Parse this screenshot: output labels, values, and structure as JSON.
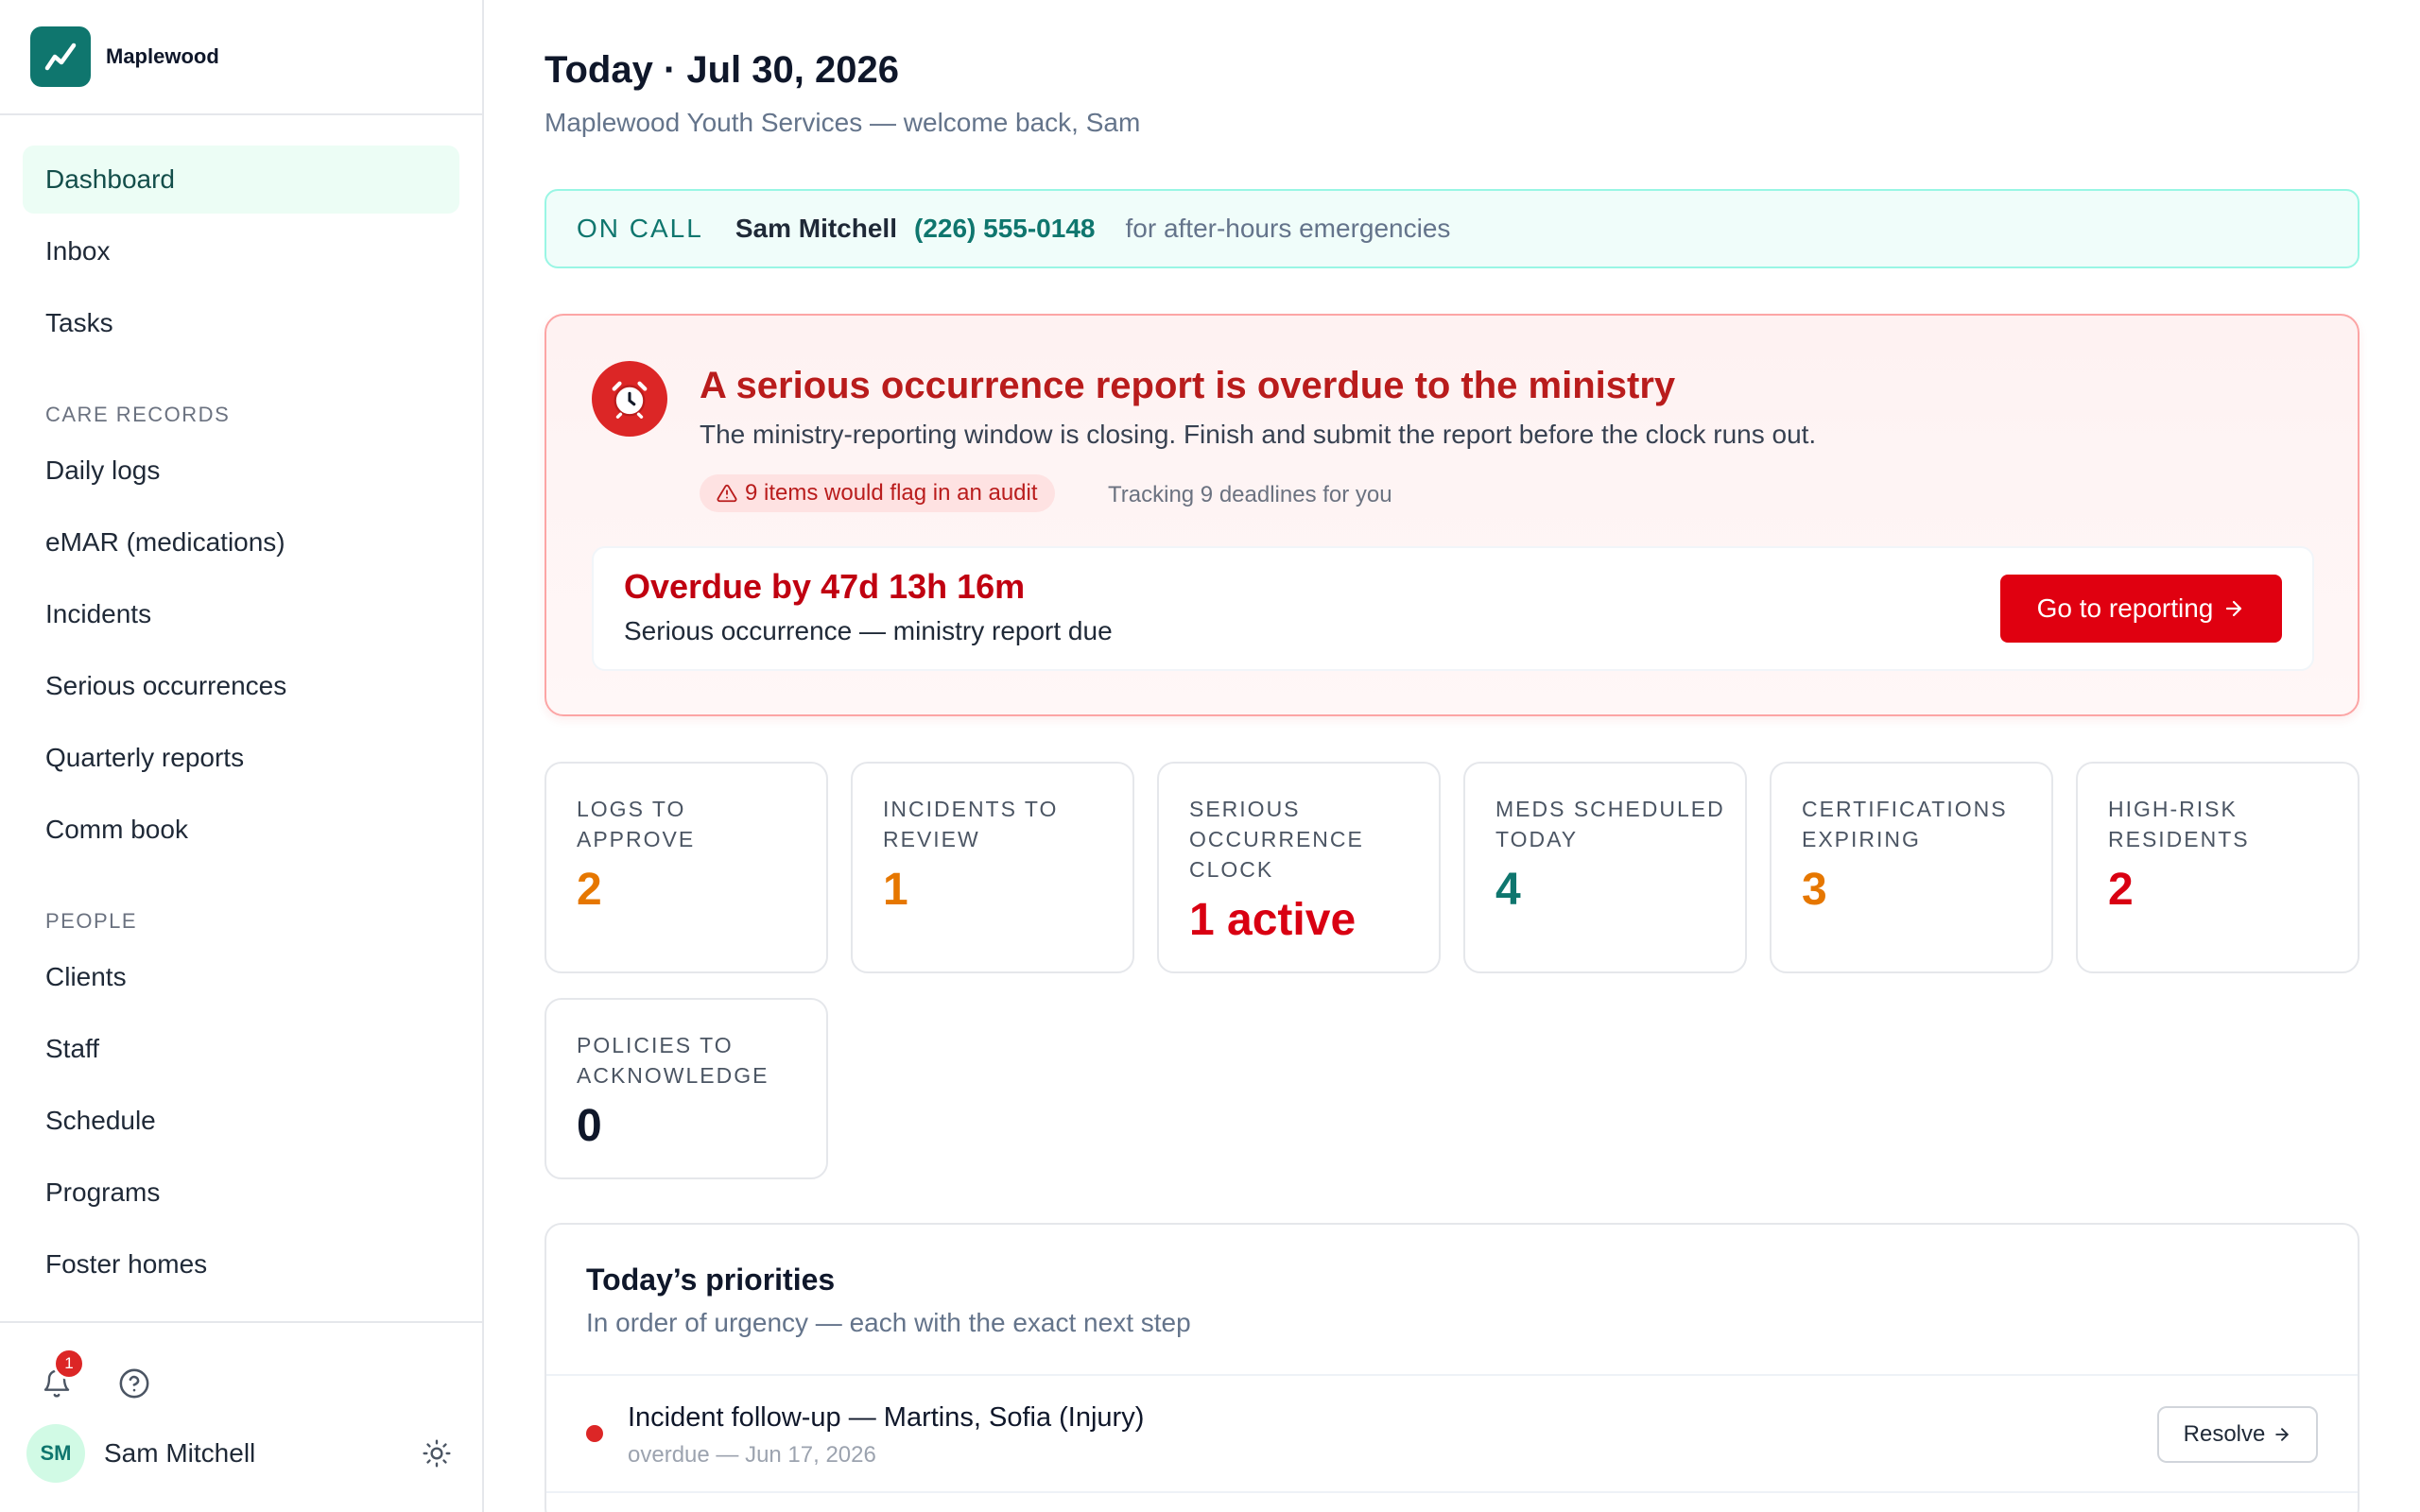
{
  "brand": {
    "name": "Maplewood"
  },
  "nav": {
    "items": [
      {
        "label": "Dashboard"
      },
      {
        "label": "Inbox"
      },
      {
        "label": "Tasks"
      }
    ],
    "care_records_heading": "CARE RECORDS",
    "care_records": [
      {
        "label": "Daily logs"
      },
      {
        "label": "eMAR (medications)"
      },
      {
        "label": "Incidents"
      },
      {
        "label": "Serious occurrences"
      },
      {
        "label": "Quarterly reports"
      },
      {
        "label": "Comm book"
      }
    ],
    "people_heading": "PEOPLE",
    "people": [
      {
        "label": "Clients"
      },
      {
        "label": "Staff"
      },
      {
        "label": "Schedule"
      },
      {
        "label": "Programs"
      },
      {
        "label": "Foster homes"
      }
    ]
  },
  "footer": {
    "notification_count": "1",
    "user_initials": "SM",
    "user_name": "Sam Mitchell"
  },
  "header": {
    "title": "Today · Jul 30, 2026",
    "subtitle": "Maplewood Youth Services — welcome back, Sam"
  },
  "oncall": {
    "label": "ON CALL",
    "name": "Sam Mitchell",
    "phone": "(226) 555-0148",
    "note": "for after-hours emergencies"
  },
  "alert": {
    "title": "A serious occurrence report is overdue to the ministry",
    "description": "The ministry-reporting window is closing. Finish and submit the report before the clock runs out.",
    "audit_pill": "9 items would flag in an audit",
    "tracking": "Tracking 9 deadlines for you",
    "overdue_time": "Overdue by 47d 13h 16m",
    "overdue_desc": "Serious occurrence — ministry report due",
    "button_label": "Go to reporting"
  },
  "stats": [
    {
      "label_lines": [
        "LOGS TO",
        "APPROVE"
      ],
      "value": "2",
      "color": "#e67700"
    },
    {
      "label_lines": [
        "INCIDENTS TO",
        "REVIEW"
      ],
      "value": "1",
      "color": "#e67700"
    },
    {
      "label_lines": [
        "SERIOUS",
        "OCCURRENCE",
        "CLOCK"
      ],
      "value": "1 active",
      "color": "#d90012"
    },
    {
      "label_lines": [
        "MEDS SCHEDULED",
        "TODAY"
      ],
      "value": "4",
      "color": "#0f766e"
    },
    {
      "label_lines": [
        "CERTIFICATIONS",
        "EXPIRING"
      ],
      "value": "3",
      "color": "#e67700"
    },
    {
      "label_lines": [
        "HIGH-RISK",
        "RESIDENTS"
      ],
      "value": "2",
      "color": "#d90012"
    },
    {
      "label_lines": [
        "POLICIES TO",
        "ACKNOWLEDGE"
      ],
      "value": "0",
      "color": "#0f172a"
    }
  ],
  "priorities": {
    "title": "Today’s priorities",
    "subtitle": "In order of urgency — each with the exact next step",
    "items": [
      {
        "title": "Incident follow-up — Martins, Sofia (Injury)",
        "meta": "overdue — Jun 17, 2026",
        "action": "Resolve"
      }
    ]
  }
}
